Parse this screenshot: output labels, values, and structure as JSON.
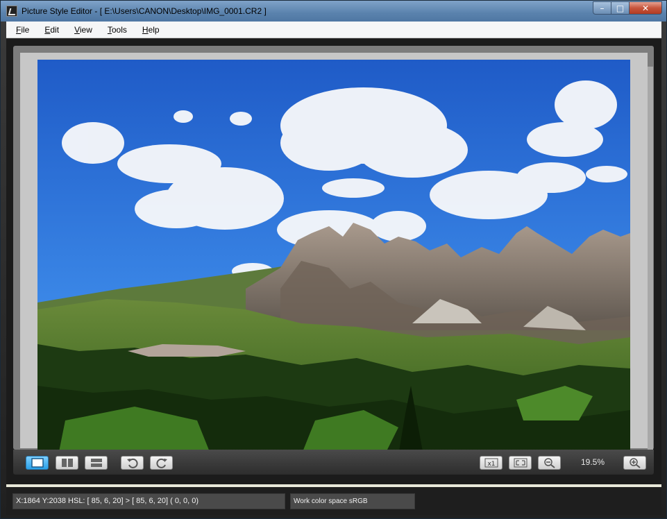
{
  "window": {
    "title": "Picture Style Editor - [ E:\\Users\\CANON\\Desktop\\IMG_0001.CR2 ]",
    "minimize_label": "–",
    "maximize_label": "□",
    "close_label": "✕"
  },
  "menu": {
    "items": [
      {
        "accel": "F",
        "rest": "ile"
      },
      {
        "accel": "E",
        "rest": "dit"
      },
      {
        "accel": "V",
        "rest": "iew"
      },
      {
        "accel": "T",
        "rest": "ools"
      },
      {
        "accel": "H",
        "rest": "elp"
      }
    ]
  },
  "viewer": {
    "image_description": "landscape-photo-dolomites"
  },
  "toolbar": {
    "view_modes": [
      "single-view",
      "side-by-side-view",
      "top-bottom-view"
    ],
    "active_view_mode": "single-view",
    "rotate_left": "rotate-left-icon",
    "rotate_right": "rotate-right-icon",
    "zoom_100": "zoom-100-icon",
    "fit_window": "fit-window-icon",
    "zoom_out": "zoom-out-icon",
    "zoom_level": "19.5%",
    "zoom_in": "zoom-in-icon"
  },
  "status": {
    "coords": "X:1864 Y:2038  HSL: [ 85,  6, 20] > [ 85,  6, 20]  (  0,  0,  0)",
    "color_space": "Work color space  sRGB"
  },
  "colors": {
    "title_bar": "#5a82ad",
    "active_button": "#2aa0e8",
    "sky": "#2a6fd6"
  }
}
